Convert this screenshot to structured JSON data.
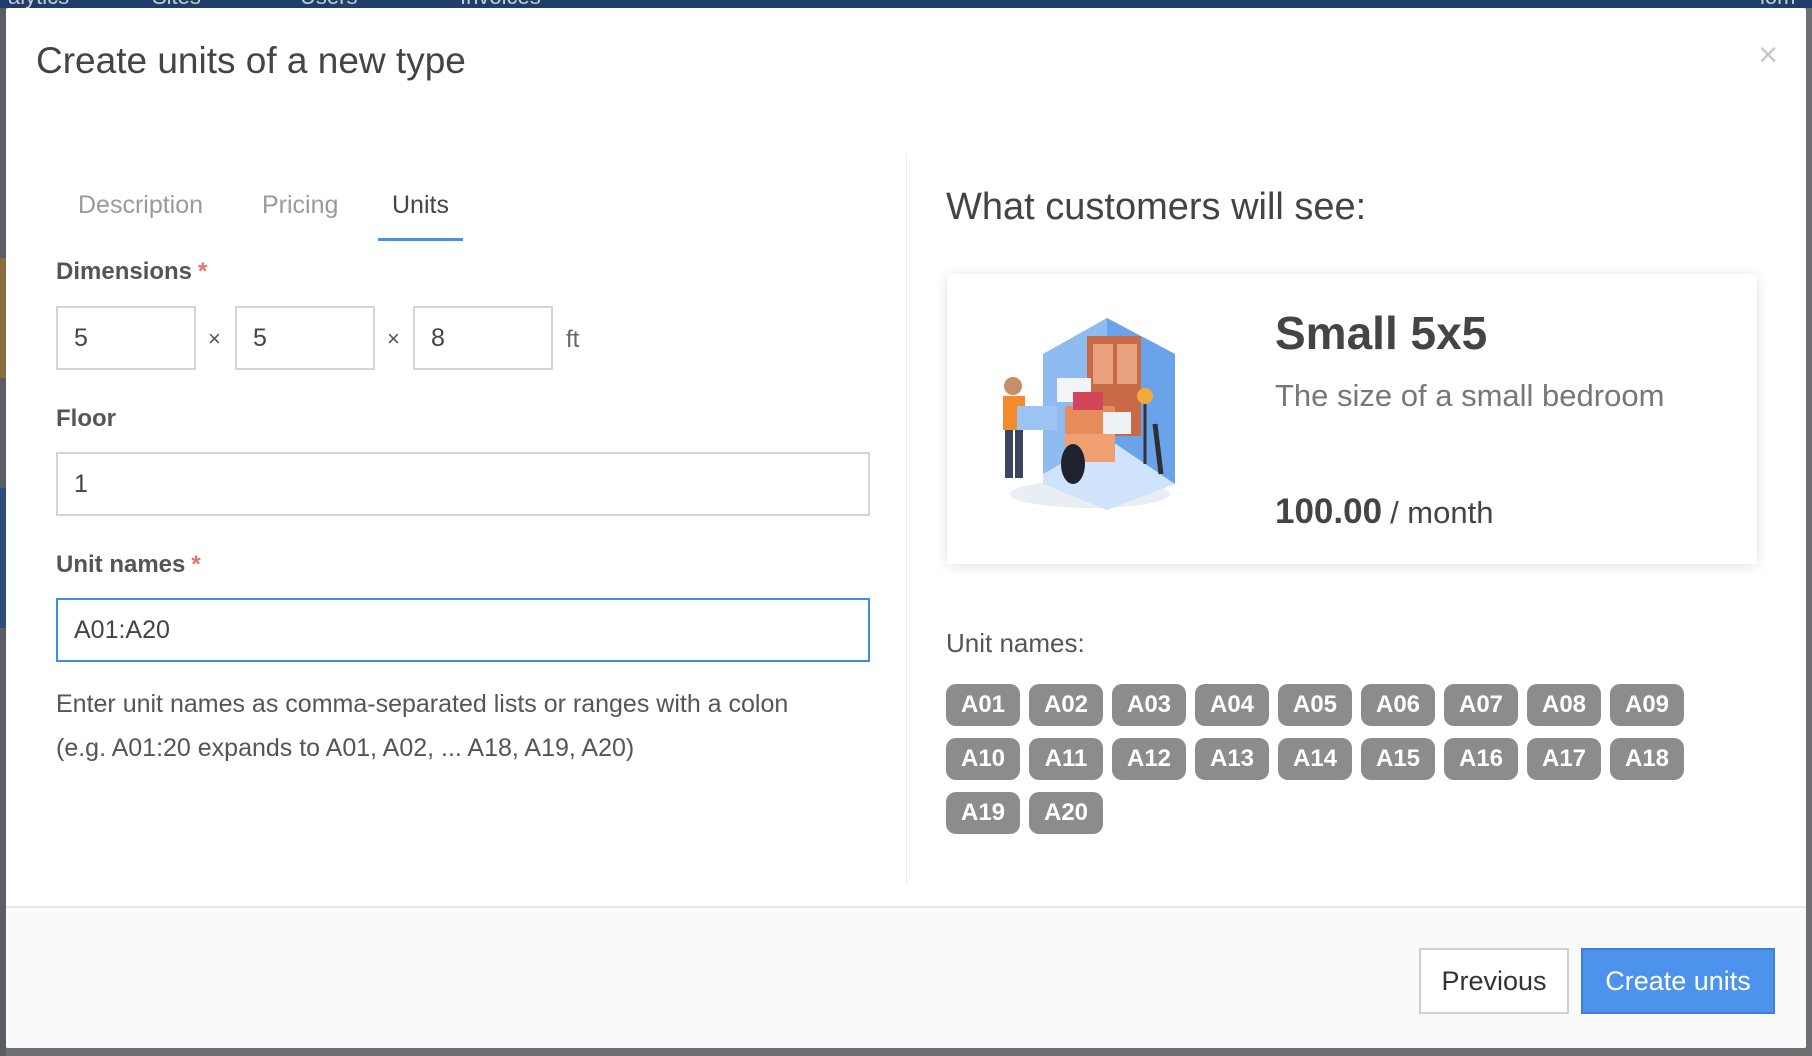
{
  "background_nav": {
    "items": [
      "alytics",
      "Sites",
      "Users",
      "Invoices",
      "iom"
    ]
  },
  "modal": {
    "title": "Create units of a new type",
    "close_symbol": "×"
  },
  "tabs": [
    {
      "label": "Description",
      "active": false
    },
    {
      "label": "Pricing",
      "active": false
    },
    {
      "label": "Units",
      "active": true
    }
  ],
  "form": {
    "dimensions": {
      "label": "Dimensions",
      "required_mark": "*",
      "values": [
        "5",
        "5",
        "8"
      ],
      "separator": "×",
      "unit": "ft"
    },
    "floor": {
      "label": "Floor",
      "value": "1"
    },
    "unit_names": {
      "label": "Unit names",
      "required_mark": "*",
      "value": "A01:A20",
      "help_line1": "Enter unit names as comma-separated lists or ranges with a colon",
      "help_line2": "(e.g. A01:20 expands to A01, A02, ... A18, A19, A20)"
    }
  },
  "preview": {
    "title": "What customers will see:",
    "card": {
      "name": "Small 5x5",
      "description": "The size of a small bedroom",
      "price": "100.00",
      "period": "/ month",
      "illustration": "storage-unit-illustration"
    },
    "unit_names_label": "Unit names:",
    "unit_chips": [
      "A01",
      "A02",
      "A03",
      "A04",
      "A05",
      "A06",
      "A07",
      "A08",
      "A09",
      "A10",
      "A11",
      "A12",
      "A13",
      "A14",
      "A15",
      "A16",
      "A17",
      "A18",
      "A19",
      "A20"
    ]
  },
  "footer": {
    "previous_label": "Previous",
    "create_label": "Create units"
  },
  "colors": {
    "accent": "#4d93ee",
    "focus_border": "#3b8ee6",
    "chip_bg": "#8c8c8c",
    "required": "#e57373"
  }
}
